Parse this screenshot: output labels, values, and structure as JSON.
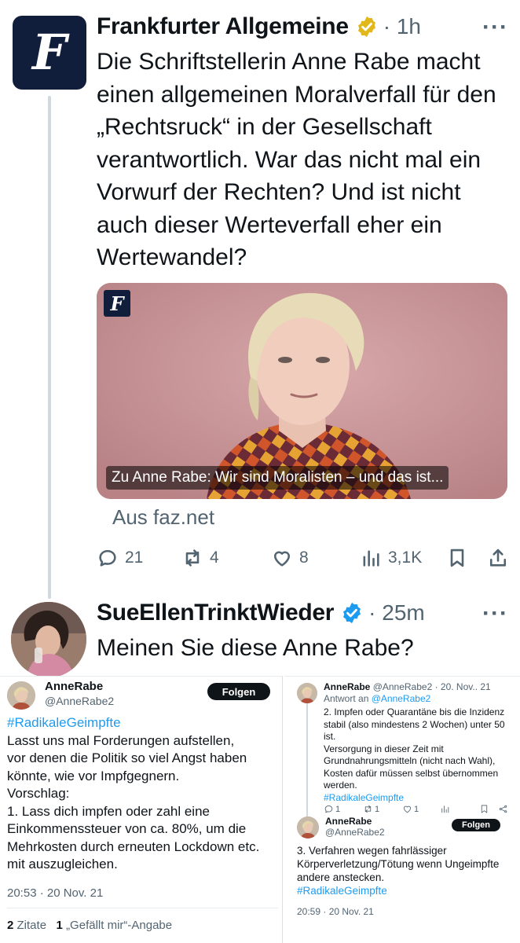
{
  "tweet1": {
    "author_name": "Frankfurter Allgemeine",
    "time": "1h",
    "more": "···",
    "text": "Die Schriftstellerin Anne Rabe macht einen allgemeinen Moralverfall für den „Rechtsruck“ in der Gesellschaft verantwortlich. War das nicht mal ein Vorwurf der Rechten? Und ist nicht auch dieser Werteverfall eher ein Wertewandel?",
    "avatar_glyph": "F",
    "card": {
      "title": "Zu Anne Rabe: Wir sind Moralisten – und das ist...",
      "logo_glyph": "F",
      "source": "Aus faz.net"
    },
    "actions": {
      "replies": "21",
      "reposts": "4",
      "likes": "8",
      "views": "3,1K"
    }
  },
  "tweet2": {
    "author_name": "SueEllenTrinktWieder",
    "time": "25m",
    "more": "···",
    "text": "Meinen Sie diese Anne Rabe?"
  },
  "embed_left": {
    "name": "AnneRabe",
    "handle": "@AnneRabe2",
    "follow_label": "Folgen",
    "hashtag": "#RadikaleGeimpfte",
    "body_lines": [
      "Lasst uns mal Forderungen aufstellen,",
      "vor denen die Politik so viel Angst haben",
      "könnte, wie vor Impfgegnern.",
      "Vorschlag:",
      "1. Lass dich impfen oder zahl eine",
      "Einkommenssteuer von ca. 80%, um die",
      "Mehrkosten durch erneuten Lockdown etc.",
      "mit auszugleichen."
    ],
    "timestamp": "20:53 · 20 Nov. 21",
    "quotes_count": "2",
    "quotes_label": "Zitate",
    "likes_count": "1",
    "likes_label": "„Gefällt mir“-Angabe"
  },
  "embed_right": {
    "name": "AnneRabe",
    "handle_date": "@AnneRabe2 · 20. Nov.. 21",
    "reply_prefix": "Antwort an",
    "reply_handle": "@AnneRabe2",
    "body_lines": [
      "2. Impfen oder Quarantäne bis die Inzidenz",
      "stabil (also mindestens 2 Wochen) unter 50",
      "ist.",
      "Versorgung in dieser Zeit mit",
      "Grundnahrungsmitteln (nicht nach Wahl),",
      "Kosten dafür müssen selbst übernommen",
      "werden."
    ],
    "hashtag": "#RadikaleGeimpfte",
    "actions": {
      "replies": "1",
      "reposts": "1",
      "likes": "1"
    },
    "name2": "AnneRabe",
    "handle2": "@AnneRabe2",
    "follow_label": "Folgen",
    "body2_lines": [
      "3. Verfahren wegen fahrlässiger",
      "Körperverletzung/Tötung wenn Ungeimpfte",
      "andere anstecken."
    ],
    "hashtag2": "#RadikaleGeimpfte",
    "timestamp2": "20:59 · 20 Nov. 21"
  },
  "colors": {
    "faz_navy": "#101d3b",
    "verified_gold": "#e2b719",
    "verified_blue": "#1d9bf0",
    "hashtag_blue": "#1d9bf0",
    "secondary_text": "#536471"
  }
}
